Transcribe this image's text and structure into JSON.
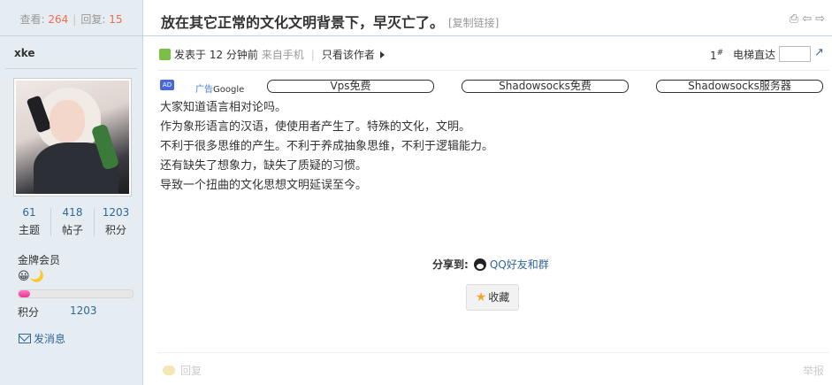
{
  "stats": {
    "views_label": "查看:",
    "views": "264",
    "replies_label": "回复:",
    "replies": "15"
  },
  "thread": {
    "title": "放在其它正常的文化文明背景下，早灭亡了。",
    "copy_link": "[复制链接]"
  },
  "author": {
    "name": "xke",
    "counts": [
      {
        "value": "61",
        "label": "主题"
      },
      {
        "value": "418",
        "label": "帖子"
      },
      {
        "value": "1203",
        "label": "积分"
      }
    ],
    "level_title": "金牌会员",
    "level_icons": "😀🌙",
    "level_progress": 0.1,
    "score_label": "积分",
    "score_value": "1203",
    "send_message": "发消息"
  },
  "meta": {
    "posted_prefix": "发表于",
    "posted_time": "12 分钟前",
    "from": "来自手机",
    "only_author": "只看该作者",
    "floor": "1",
    "floor_sup": "#",
    "elevator": "电梯直达"
  },
  "ads": {
    "badge": "AD",
    "label_prefix": "广告",
    "label_brand": "Google",
    "items": [
      "Vps免费",
      "Shadowsocks免费",
      "Shadowsocks服务器"
    ]
  },
  "content": {
    "lines": [
      "大家知道语言相对论吗。",
      "作为象形语言的汉语，使使用者产生了。特殊的文化，文明。",
      "不利于很多思维的产生。不利于养成抽象思维，不利于逻辑能力。",
      "还有缺失了想象力，缺失了质疑的习惯。",
      "导致一个扭曲的文化思想文明延误至今。"
    ]
  },
  "share": {
    "label": "分享到:",
    "qq": "QQ好友和群",
    "favorite": "收藏"
  },
  "footer": {
    "reply": "回复",
    "report": "举报"
  },
  "colors": {
    "accent": "#336699",
    "highlight": "#f26c4f",
    "sidebar_bg": "#e5edf2",
    "border": "#c2d5e3"
  }
}
